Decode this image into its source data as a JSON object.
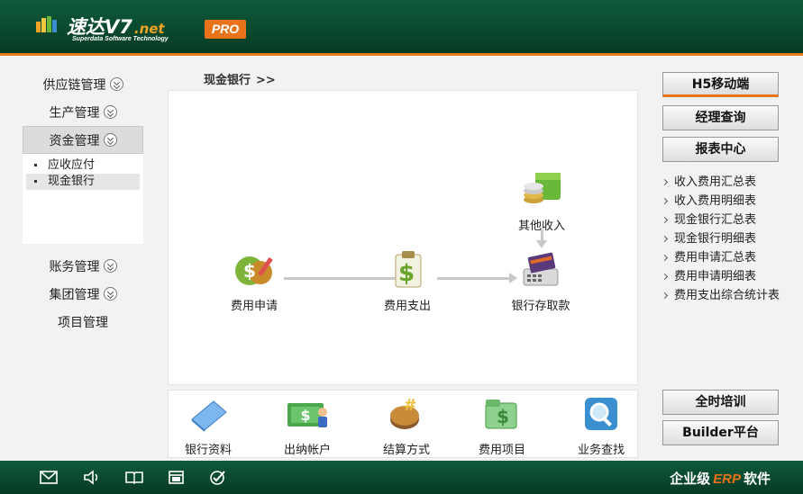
{
  "header": {
    "brand_name": "速达V7",
    "brand_suffix": ".net",
    "brand_sub": "Superdata Software Technology",
    "badge": "PRO"
  },
  "left_nav": {
    "items": [
      {
        "label": "供应链管理"
      },
      {
        "label": "生产管理"
      },
      {
        "label": "资金管理"
      },
      {
        "label": "账务管理"
      },
      {
        "label": "集团管理"
      },
      {
        "label": "项目管理"
      }
    ],
    "sub_items": [
      {
        "label": "应收应付"
      },
      {
        "label": "现金银行"
      }
    ]
  },
  "breadcrumb": {
    "label": "现金银行",
    "sep": ">>"
  },
  "flow": {
    "nodes": [
      {
        "label": "费用申请",
        "icon": "expense-apply-icon"
      },
      {
        "label": "费用支出",
        "icon": "expense-pay-icon"
      },
      {
        "label": "银行存取款",
        "icon": "bank-deposit-icon"
      },
      {
        "label": "其他收入",
        "icon": "other-income-icon"
      }
    ]
  },
  "shortcuts": [
    {
      "label": "银行资料",
      "icon": "bank-data-icon"
    },
    {
      "label": "出纳帐户",
      "icon": "cashier-account-icon"
    },
    {
      "label": "结算方式",
      "icon": "settlement-icon"
    },
    {
      "label": "费用项目",
      "icon": "expense-item-icon"
    },
    {
      "label": "业务查找",
      "icon": "search-icon"
    }
  ],
  "right": {
    "top_buttons": [
      "H5移动端",
      "经理查询",
      "报表中心"
    ],
    "reports": [
      "收入费用汇总表",
      "收入费用明细表",
      "现金银行汇总表",
      "现金银行明细表",
      "费用申请汇总表",
      "费用申请明细表",
      "费用支出综合统计表"
    ],
    "bottom_buttons": [
      "全时培训",
      "Builder平台"
    ]
  },
  "footer": {
    "brand_pre": "企业级",
    "brand_erp": "ERP",
    "brand_post": "软件",
    "icons": [
      "mail-icon",
      "speaker-icon",
      "book-icon",
      "window-icon",
      "check-icon"
    ]
  },
  "colors": {
    "header_green": "#0a4a2e",
    "accent_orange": "#e8731b"
  }
}
